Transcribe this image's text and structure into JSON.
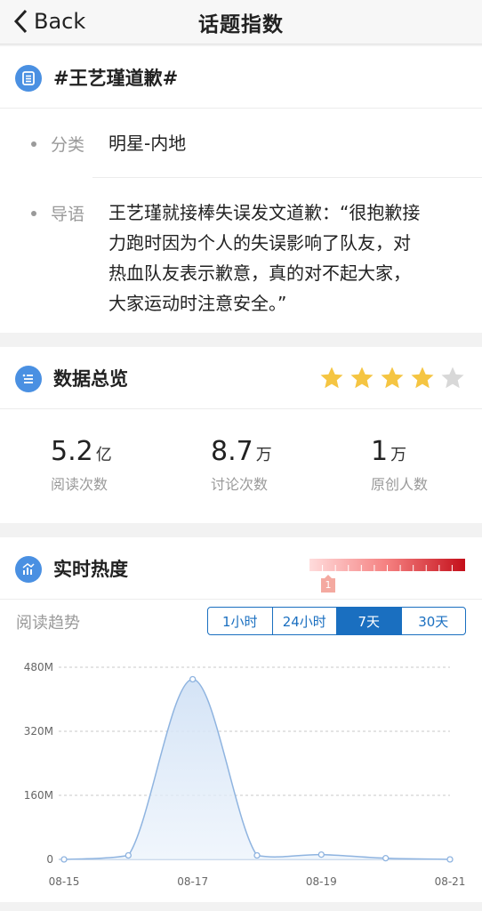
{
  "nav": {
    "back_label": "Back",
    "title": "话题指数"
  },
  "topic": {
    "title": "#王艺瑾道歉#",
    "category_label": "分类",
    "category_value": "明星-内地",
    "intro_label": "导语",
    "intro_lines": [
      "王艺瑾就接棒失误发文道歉：“很抱歉接",
      "力跑时因为个人的失误影响了队友，对",
      "热血队友表示歉意，真的对不起大家，",
      "大家运动时注意安全。”"
    ]
  },
  "overview": {
    "title": "数据总览",
    "rating": {
      "filled": 4,
      "total": 5
    },
    "stats": [
      {
        "value": "5.2",
        "unit": "亿",
        "label": "阅读次数"
      },
      {
        "value": "8.7",
        "unit": "万",
        "label": "讨论次数"
      },
      {
        "value": "1",
        "unit": "万",
        "label": "原创人数"
      }
    ]
  },
  "heat": {
    "title": "实时热度",
    "level": "1",
    "trend_label": "阅读趋势",
    "ranges": [
      "1小时",
      "24小时",
      "7天",
      "30天"
    ],
    "active_range": "7天"
  },
  "colors": {
    "accent": "#1a6fc0",
    "icon_bg": "#4a90e2",
    "star": "#f5c542",
    "star_off": "#d8d8d8"
  },
  "chart_data": {
    "type": "area",
    "x": [
      "08-15",
      "08-16",
      "08-17",
      "08-18",
      "08-19",
      "08-20",
      "08-21"
    ],
    "x_tick_labels": [
      "08-15",
      "08-17",
      "08-19",
      "08-21"
    ],
    "values": [
      0,
      10,
      450,
      10,
      12,
      3,
      0
    ],
    "y_unit": "M",
    "yticks": [
      "0",
      "160M",
      "320M",
      "480M"
    ],
    "ylim": [
      0,
      480
    ],
    "grid": true
  }
}
